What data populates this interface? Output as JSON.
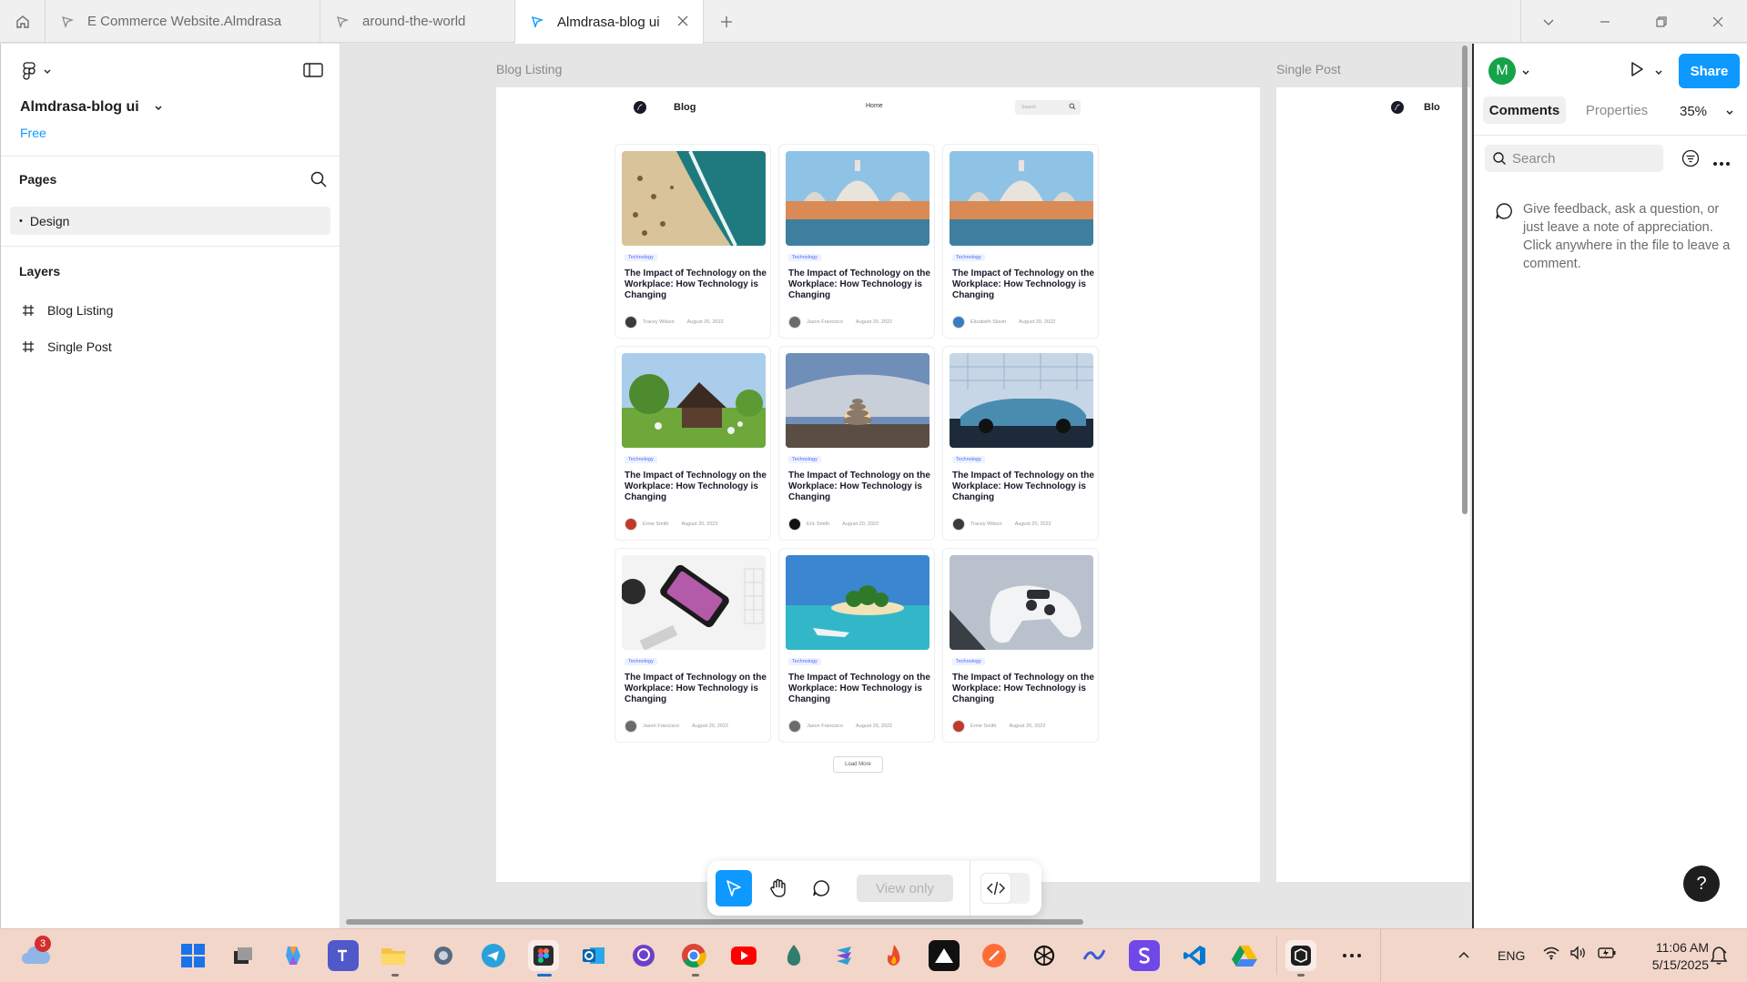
{
  "tabs": [
    {
      "label": "E Commerce Website.Almdrasa",
      "active": false
    },
    {
      "label": "around-the-world",
      "active": false
    },
    {
      "label": "Almdrasa-blog ui",
      "active": true
    }
  ],
  "left_panel": {
    "file_title": "Almdrasa-blog ui",
    "plan": "Free",
    "pages_title": "Pages",
    "pages": [
      {
        "label": "Design",
        "bullet": "•"
      }
    ],
    "layers_title": "Layers",
    "layers": [
      {
        "label": "Blog Listing"
      },
      {
        "label": "Single Post"
      }
    ]
  },
  "canvas": {
    "frame_labels": [
      "Blog Listing",
      "Single Post"
    ],
    "blog": {
      "brand": "Blog",
      "nav_home": "Home",
      "search_placeholder": "Search",
      "load_more": "Load More",
      "cards": [
        {
          "tag": "Technology",
          "title": "The Impact of Technology on the Workplace: How Technology is Changing",
          "author": "Tracey Wilson",
          "date": "August 20, 2022",
          "image": "beach"
        },
        {
          "tag": "Technology",
          "title": "The Impact of Technology on the Workplace: How Technology is Changing",
          "author": "Jason Francisco",
          "date": "August 20, 2022",
          "image": "venice"
        },
        {
          "tag": "Technology",
          "title": "The Impact of Technology on the Workplace: How Technology is Changing",
          "author": "Elizabeth Slavin",
          "date": "August 20, 2022",
          "image": "venice"
        },
        {
          "tag": "Technology",
          "title": "The Impact of Technology on the Workplace: How Technology is Changing",
          "author": "Ernie Smith",
          "date": "August 20, 2022",
          "image": "house"
        },
        {
          "tag": "Technology",
          "title": "The Impact of Technology on the Workplace: How Technology is Changing",
          "author": "Eric Smith",
          "date": "August 20, 2022",
          "image": "stones"
        },
        {
          "tag": "Technology",
          "title": "The Impact of Technology on the Workplace: How Technology is Changing",
          "author": "Tracey Wilson",
          "date": "August 20, 2022",
          "image": "car"
        },
        {
          "tag": "Technology",
          "title": "The Impact of Technology on the Workplace: How Technology is Changing",
          "author": "Jason Francisco",
          "date": "August 20, 2022",
          "image": "phone"
        },
        {
          "tag": "Technology",
          "title": "The Impact of Technology on the Workplace: How Technology is Changing",
          "author": "Jason Francisco",
          "date": "August 20, 2022",
          "image": "island"
        },
        {
          "tag": "Technology",
          "title": "The Impact of Technology on the Workplace: How Technology is Changing",
          "author": "Ernie Smith",
          "date": "August 20, 2022",
          "image": "controller"
        }
      ],
      "single_post_brand": "Blo"
    }
  },
  "toolbar": {
    "view_only": "View only",
    "icons": [
      "move-pointer-icon",
      "hand-icon",
      "comment-icon",
      "code-icon"
    ]
  },
  "right_panel": {
    "avatar_initial": "M",
    "share_label": "Share",
    "tabs": [
      "Comments",
      "Properties"
    ],
    "zoom": "35%",
    "search_placeholder": "Search",
    "hint": "Give feedback, ask a question, or just leave a note of appreciation. Click anywhere in the file to leave a comment.",
    "help": "?"
  },
  "taskbar": {
    "weather_badge": "3",
    "language": "ENG",
    "time": "11:06 AM",
    "date": "5/15/2025"
  },
  "colors": {
    "accent": "#0d99ff",
    "tag_blue": "#4b6bfb",
    "taskbar": "#f2d6c9"
  }
}
